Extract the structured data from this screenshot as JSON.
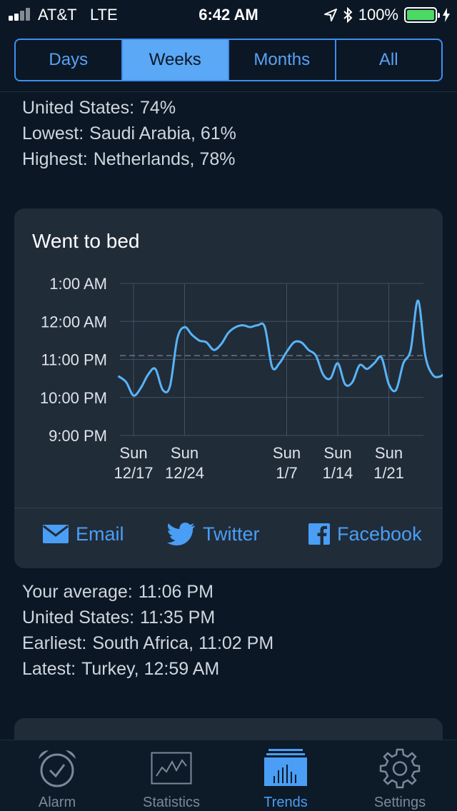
{
  "status": {
    "carrier": "AT&T",
    "network": "LTE",
    "time": "6:42 AM",
    "battery": "100%"
  },
  "segments": [
    {
      "label": "Days",
      "active": false
    },
    {
      "label": "Weeks",
      "active": true
    },
    {
      "label": "Months",
      "active": false
    },
    {
      "label": "All",
      "active": false
    }
  ],
  "top_stats": [
    {
      "label": "United States:",
      "value": "74%"
    },
    {
      "label": "Lowest:",
      "value": "Saudi Arabia, 61%"
    },
    {
      "label": "Highest:",
      "value": "Netherlands, 78%"
    }
  ],
  "card": {
    "title": "Went to bed",
    "share": {
      "email": "Email",
      "twitter": "Twitter",
      "facebook": "Facebook"
    }
  },
  "chart_data": {
    "type": "line",
    "y_ticks": [
      "1:00 AM",
      "12:00 AM",
      "11:00 PM",
      "10:00 PM",
      "9:00 PM"
    ],
    "x_ticks": [
      {
        "day": "Sun",
        "date": "12/17"
      },
      {
        "day": "Sun",
        "date": "12/24"
      },
      {
        "day": "Sun",
        "date": "1/7"
      },
      {
        "day": "Sun",
        "date": "1/14"
      },
      {
        "day": "Sun",
        "date": "1/21"
      }
    ],
    "x_tick_days": [
      7,
      14,
      28,
      35,
      42
    ],
    "y_range_hours_after_9pm": [
      0,
      4
    ],
    "average_hours_after_9pm": 2.1,
    "series": [
      {
        "color": "#58b4f8",
        "points": [
          [
            5,
            1.55
          ],
          [
            6,
            1.4
          ],
          [
            7,
            1.05
          ],
          [
            8,
            1.25
          ],
          [
            9,
            1.6
          ],
          [
            10,
            1.75
          ],
          [
            11,
            1.2
          ],
          [
            12,
            1.3
          ],
          [
            13,
            2.55
          ],
          [
            14,
            2.85
          ],
          [
            15,
            2.65
          ],
          [
            16,
            2.5
          ],
          [
            17,
            2.45
          ],
          [
            18,
            2.25
          ],
          [
            19,
            2.4
          ],
          [
            20,
            2.7
          ],
          [
            21,
            2.85
          ],
          [
            22,
            2.9
          ],
          [
            23,
            2.85
          ],
          [
            24,
            2.9
          ],
          [
            25,
            2.85
          ],
          [
            26,
            1.8
          ],
          [
            27,
            1.9
          ],
          [
            28,
            2.2
          ],
          [
            29,
            2.45
          ],
          [
            30,
            2.45
          ],
          [
            31,
            2.25
          ],
          [
            32,
            2.1
          ],
          [
            33,
            1.6
          ],
          [
            34,
            1.5
          ],
          [
            35,
            1.9
          ],
          [
            36,
            1.35
          ],
          [
            37,
            1.4
          ],
          [
            38,
            1.85
          ],
          [
            39,
            1.75
          ],
          [
            40,
            1.9
          ],
          [
            41,
            2.05
          ],
          [
            42,
            1.35
          ],
          [
            43,
            1.2
          ],
          [
            44,
            1.9
          ],
          [
            45,
            2.25
          ],
          [
            46,
            3.55
          ],
          [
            47,
            2.1
          ],
          [
            48,
            1.6
          ],
          [
            49,
            1.55
          ],
          [
            50,
            1.7
          ],
          [
            51,
            1.95
          ],
          [
            52,
            2.1
          ],
          [
            53,
            2.15
          ],
          [
            54,
            2.45
          ],
          [
            55,
            2.95
          ],
          [
            56,
            2.65
          ],
          [
            57,
            2.35
          ],
          [
            58,
            2.75
          ],
          [
            59,
            2.8
          ],
          [
            60,
            2.05
          ],
          [
            61,
            1.85
          ],
          [
            62,
            1.85
          ],
          [
            63,
            2.45
          ],
          [
            64,
            2.6
          ],
          [
            65,
            2.45
          ],
          [
            66,
            2.0
          ],
          [
            67,
            1.75
          ],
          [
            68,
            1.65
          ],
          [
            69,
            1.6
          ],
          [
            70,
            2.35
          ],
          [
            71,
            2.5
          ],
          [
            72,
            2.3
          ]
        ]
      }
    ]
  },
  "bottom_stats": [
    {
      "label": "Your average:",
      "value": "11:06 PM"
    },
    {
      "label": "United States:",
      "value": "11:35 PM"
    },
    {
      "label": "Earliest:",
      "value": "South Africa, 11:02 PM"
    },
    {
      "label": "Latest:",
      "value": "Turkey, 12:59 AM"
    }
  ],
  "tabs": [
    {
      "label": "Alarm",
      "icon": "alarm-clock-icon",
      "active": false
    },
    {
      "label": "Statistics",
      "icon": "statistics-icon",
      "active": false
    },
    {
      "label": "Trends",
      "icon": "trends-icon",
      "active": true
    },
    {
      "label": "Settings",
      "icon": "gear-icon",
      "active": false
    }
  ]
}
